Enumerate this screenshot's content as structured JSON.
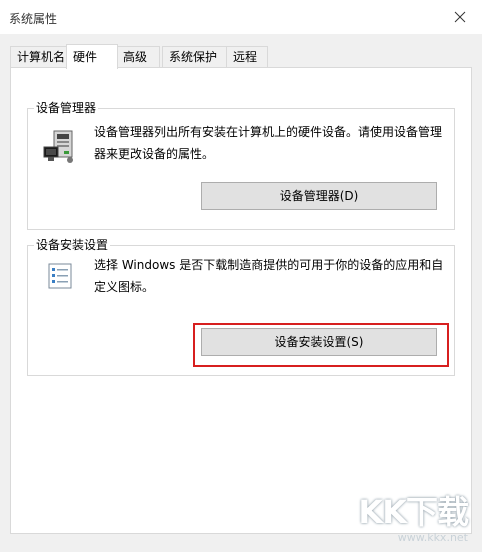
{
  "window": {
    "title": "系统属性"
  },
  "tabs": [
    {
      "label": "计算机名"
    },
    {
      "label": "硬件"
    },
    {
      "label": "高级"
    },
    {
      "label": "系统保护"
    },
    {
      "label": "远程"
    }
  ],
  "active_tab": "硬件",
  "device_manager": {
    "group_title": "设备管理器",
    "description": "设备管理器列出所有安装在计算机上的硬件设备。请使用设备管理器来更改设备的属性。",
    "button_label": "设备管理器(D)",
    "icon": "device-manager-icon"
  },
  "device_install": {
    "group_title": "设备安装设置",
    "description": "选择 Windows 是否下载制造商提供的可用于你的设备的应用和自定义图标。",
    "button_label": "设备安装设置(S)",
    "icon": "checklist-icon"
  },
  "highlight_color": "#d71f1f",
  "watermark": {
    "logo": "KK下载",
    "url": "www.kkx.net"
  }
}
